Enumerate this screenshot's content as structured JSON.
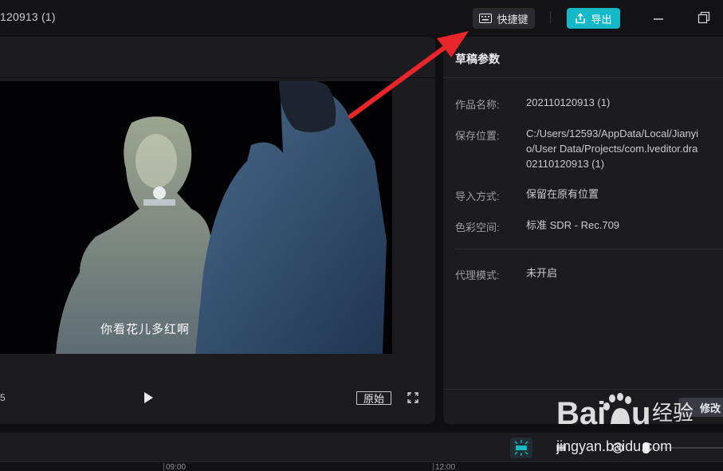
{
  "titlebar": {
    "project_title": "120913 (1)",
    "shortcut_label": "快捷键",
    "export_label": "导出",
    "icons": {
      "shortcut": "keyboard-icon",
      "export": "upload-icon",
      "minimize": "minimize-icon",
      "restore": "restore-icon"
    }
  },
  "player": {
    "subtitle": "你看花儿多红啊",
    "time_fragment": "5",
    "ratio_label": "原始",
    "icons": {
      "play": "play-icon",
      "fullscreen": "fullscreen-icon"
    }
  },
  "draft": {
    "title": "草稿参数",
    "props": [
      {
        "label": "作品名称:",
        "lines": [
          "202110120913 (1)"
        ]
      },
      {
        "label": "保存位置:",
        "lines": [
          "C:/Users/12593/AppData/Local/Jianyi",
          "o/User Data/Projects/com.lveditor.dra",
          "02110120913 (1)"
        ]
      },
      {
        "label": "导入方式:",
        "lines": [
          "保留在原有位置"
        ]
      },
      {
        "label": "色彩空间:",
        "lines": [
          "标准 SDR - Rec.709"
        ]
      },
      {
        "label": "代理模式:",
        "lines": [
          "未开启"
        ]
      }
    ],
    "modify_label": "修改"
  },
  "timeline": {
    "ticks": [
      "09:00",
      "12:00"
    ],
    "icons": {
      "snap": "snap-icon",
      "link": "link-icon",
      "preview": "preview-icon"
    }
  },
  "watermark": {
    "brand": "Baidu",
    "brand_cn": "经验",
    "url": "jingyan.baidu.com"
  },
  "colors": {
    "accent": "#16b8c8",
    "arrow": "#e8252a",
    "panel": "#1c1c20",
    "background": "#0f0f12"
  }
}
